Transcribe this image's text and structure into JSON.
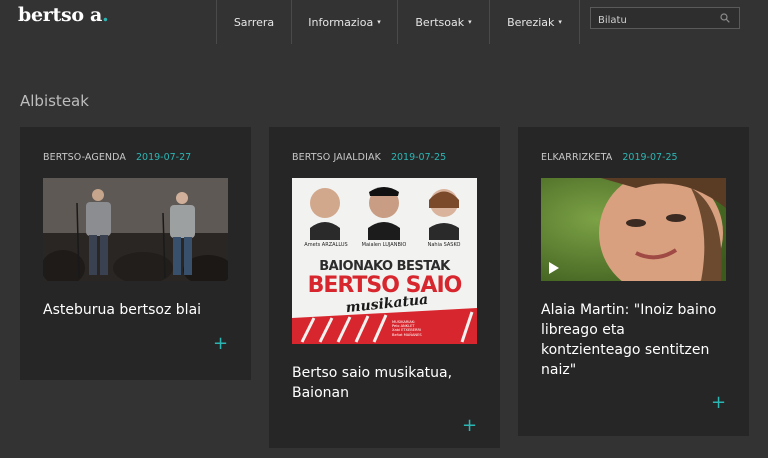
{
  "header": {
    "logo_text": "bertso a",
    "logo_dot": ".",
    "nav": [
      {
        "label": "Sarrera",
        "caret": ""
      },
      {
        "label": "Informazioa",
        "caret": "▾"
      },
      {
        "label": "Bertsoak",
        "caret": "▾"
      },
      {
        "label": "Bereziak",
        "caret": "▾"
      }
    ],
    "search_placeholder": "Bilatu"
  },
  "section_title": "Albisteak",
  "cards": [
    {
      "category": "BERTSO-AGENDA",
      "date": "2019-07-27",
      "title": "Asteburua bertsoz blai",
      "plus": "+"
    },
    {
      "category": "BERTSO JAIALDIAK",
      "date": "2019-07-25",
      "title": "Bertso saio musikatua, Baionan",
      "plus": "+"
    },
    {
      "category": "ELKARRIZKETA",
      "date": "2019-07-25",
      "title": "Alaia Martin: \"Inoiz baino libreago eta kontzienteago sentitzen naiz\"",
      "plus": "+"
    }
  ],
  "poster": {
    "names": [
      "Amets ARZALLUS",
      "Maialen LUJANBIO",
      "Nahia SASKO"
    ],
    "line1": "BAIONAKO BESTAK",
    "line2": "BERTSO SAIO",
    "line3": "musikatua",
    "credits": [
      "MUSIKARIAK:",
      "Peio ANKLET",
      "Xabi ETXEBERRI",
      "Beñat MAÑANES"
    ]
  },
  "colors": {
    "accent": "#2bb6b4",
    "background": "#333333",
    "card": "#262626",
    "poster_red": "#d7262d"
  }
}
